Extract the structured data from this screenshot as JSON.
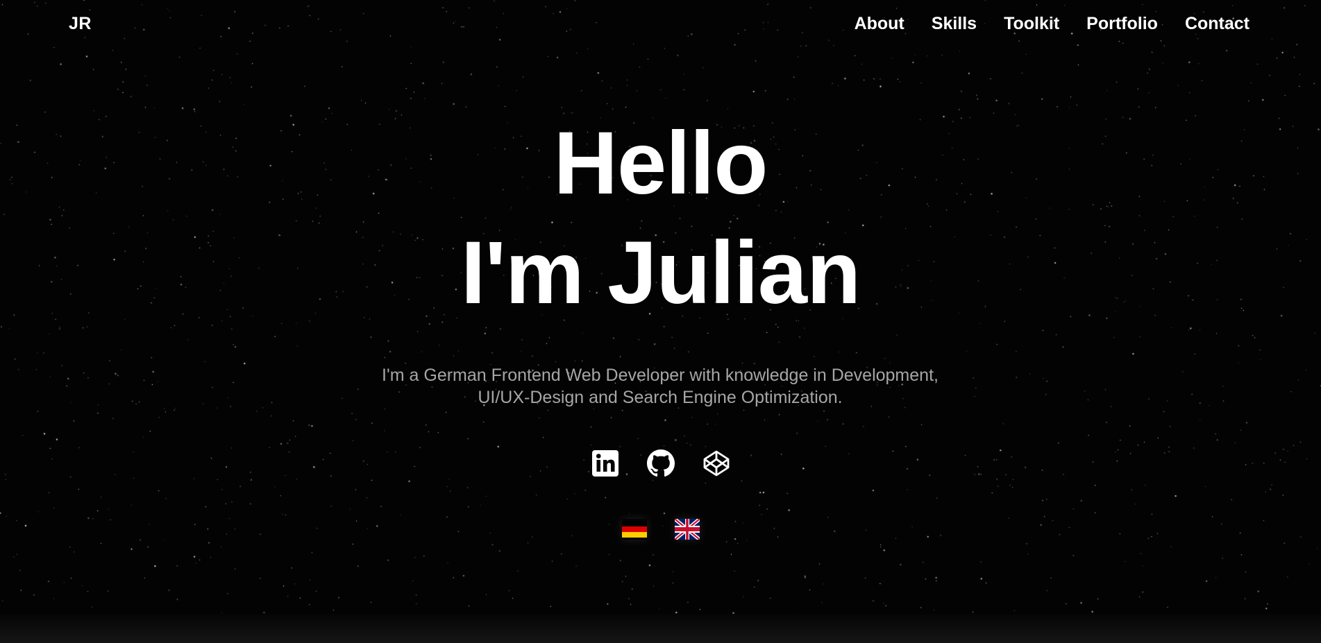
{
  "header": {
    "logo": "JR",
    "nav": [
      {
        "label": "About"
      },
      {
        "label": "Skills"
      },
      {
        "label": "Toolkit"
      },
      {
        "label": "Portfolio"
      },
      {
        "label": "Contact"
      }
    ]
  },
  "hero": {
    "line1": "Hello",
    "line2": "I'm Julian",
    "subtitle_line1": "I'm a German Frontend Web Developer with knowledge in Development,",
    "subtitle_line2": "UI/UX-Design and Search Engine Optimization."
  },
  "socials": [
    {
      "icon": "linkedin-icon"
    },
    {
      "icon": "github-icon"
    },
    {
      "icon": "codepen-icon"
    }
  ],
  "languages": [
    {
      "flag": "germany-flag-icon"
    },
    {
      "flag": "uk-flag-icon"
    }
  ],
  "colors": {
    "background": "#030303",
    "text": "#ffffff",
    "subtitle": "#a6a6a6"
  }
}
